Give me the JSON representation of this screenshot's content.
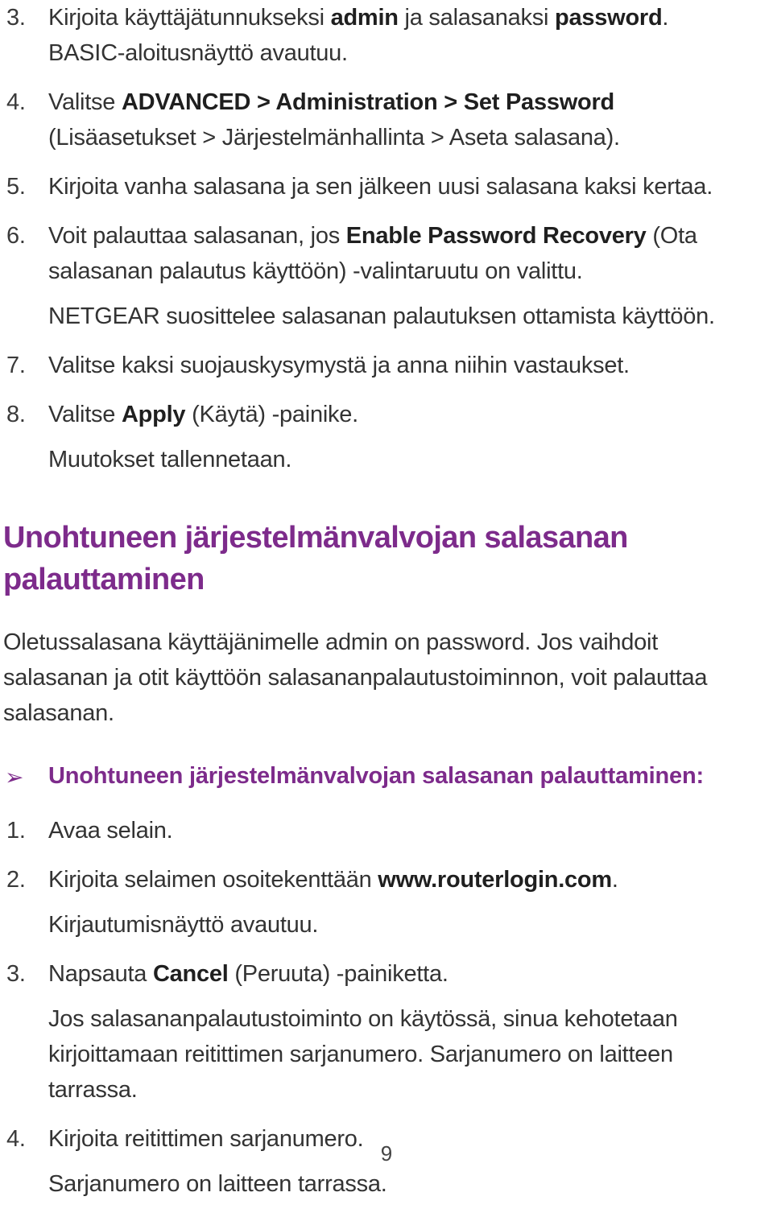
{
  "document": {
    "language": "fi",
    "page_number": "9",
    "accent_color": "#7d2b8b",
    "text_color": "#333333"
  },
  "top_list": {
    "items": [
      {
        "number": "3.",
        "parts": [
          {
            "t": "Kirjoita käyttäjätunnukseksi ",
            "b": false
          },
          {
            "t": "admin",
            "b": true
          },
          {
            "t": " ja salasanaksi ",
            "b": false
          },
          {
            "t": "password",
            "b": true
          },
          {
            "t": ".",
            "b": false
          }
        ],
        "continuations": [
          {
            "tight": true,
            "parts": [
              {
                "t": "BASIC-aloitusnäyttö avautuu.",
                "b": false
              }
            ]
          }
        ]
      },
      {
        "number": "4.",
        "parts": [
          {
            "t": "Valitse ",
            "b": false
          },
          {
            "t": "ADVANCED > Administration > Set Password",
            "b": true
          }
        ],
        "continuations": [
          {
            "tight": true,
            "parts": [
              {
                "t": "(Lisäasetukset > Järjestelmänhallinta > Aseta salasana).",
                "b": false
              }
            ]
          }
        ]
      },
      {
        "number": "5.",
        "parts": [
          {
            "t": "Kirjoita vanha salasana ja sen jälkeen uusi salasana kaksi kertaa.",
            "b": false
          }
        ],
        "continuations": []
      },
      {
        "number": "6.",
        "parts": [
          {
            "t": "Voit palauttaa salasanan, jos ",
            "b": false
          },
          {
            "t": "Enable Password Recovery",
            "b": true
          },
          {
            "t": " (Ota salasanan palautus käyttöön) -valintaruutu on valittu.",
            "b": false
          }
        ],
        "continuations": [
          {
            "tight": false,
            "parts": [
              {
                "t": "NETGEAR suosittelee salasanan palautuksen ottamista käyttöön.",
                "b": false
              }
            ]
          }
        ]
      },
      {
        "number": "7.",
        "parts": [
          {
            "t": "Valitse kaksi suojauskysymystä ja anna niihin vastaukset.",
            "b": false
          }
        ],
        "continuations": []
      },
      {
        "number": "8.",
        "parts": [
          {
            "t": "Valitse ",
            "b": false
          },
          {
            "t": "Apply",
            "b": true
          },
          {
            "t": " (Käytä) -painike.",
            "b": false
          }
        ],
        "continuations": [
          {
            "tight": false,
            "parts": [
              {
                "t": "Muutokset tallennetaan.",
                "b": false
              }
            ]
          }
        ]
      }
    ]
  },
  "section": {
    "heading": "Unohtuneen järjestelmänvalvojan salasanan palauttaminen",
    "intro": [
      {
        "t": "Oletussalasana käyttäjänimelle admin on password. Jos vaihdoit salasanan ja otit käyttöön salasananpalautustoiminnon, voit palauttaa salasanan.",
        "b": false
      }
    ],
    "subheading": {
      "arrow_icon": "arrow-bullet-icon",
      "arrow_glyph": "➢",
      "text": "Unohtuneen järjestelmänvalvojan salasanan palauttaminen:"
    }
  },
  "bottom_list": {
    "items": [
      {
        "number": "1.",
        "parts": [
          {
            "t": "Avaa selain.",
            "b": false
          }
        ],
        "continuations": []
      },
      {
        "number": "2.",
        "parts": [
          {
            "t": "Kirjoita selaimen osoitekenttään ",
            "b": false
          },
          {
            "t": "www.routerlogin.com",
            "b": true
          },
          {
            "t": ".",
            "b": false
          }
        ],
        "continuations": [
          {
            "tight": false,
            "parts": [
              {
                "t": "Kirjautumisnäyttö avautuu.",
                "b": false
              }
            ]
          }
        ]
      },
      {
        "number": "3.",
        "parts": [
          {
            "t": "Napsauta ",
            "b": false
          },
          {
            "t": "Cancel",
            "b": true
          },
          {
            "t": " (Peruuta) -painiketta.",
            "b": false
          }
        ],
        "continuations": [
          {
            "tight": false,
            "parts": [
              {
                "t": "Jos salasananpalautustoiminto on käytössä, sinua kehotetaan kirjoittamaan reitittimen sarjanumero. Sarjanumero on laitteen tarrassa.",
                "b": false
              }
            ]
          }
        ]
      },
      {
        "number": "4.",
        "parts": [
          {
            "t": "Kirjoita reitittimen sarjanumero.",
            "b": false
          }
        ],
        "continuations": [
          {
            "tight": false,
            "parts": [
              {
                "t": "Sarjanumero on laitteen tarrassa.",
                "b": false
              }
            ]
          }
        ]
      }
    ]
  }
}
